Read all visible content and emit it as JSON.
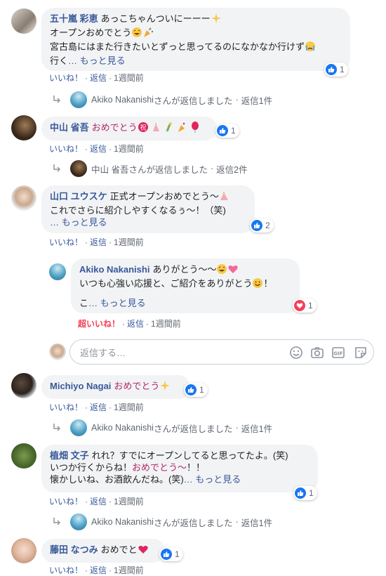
{
  "comments": [
    {
      "author": "五十嵐 彩恵",
      "text_line1": "あっこちゃんついにーーー",
      "text_line2": "オープンおめでとう",
      "text_line3": "宮古島にはまた行きたいとずっと思ってるのになかなか行けず",
      "text_line4": "行く",
      "see_more": "… もっと見る",
      "reaction_count": "1",
      "like": "いいね！",
      "reply": "返信",
      "time": "1週間前",
      "reply_summary": {
        "name": "Akiko Nakanishi",
        "suffix": "さんが返信しました",
        "count": "返信1件"
      }
    },
    {
      "author": "中山 省吾",
      "text": "おめでとう",
      "reaction_count": "1",
      "like": "いいね！",
      "reply": "返信",
      "time": "1週間前",
      "reply_summary": {
        "name": "中山 省吾",
        "suffix": "さんが返信しました",
        "count": "返信2件"
      }
    },
    {
      "author": "山口 ユウスケ",
      "text_line1": "正式オープンおめでとう〜",
      "text_line2": "これでさらに紹介しやすくなるぅ〜！（笑)",
      "see_more": "… もっと見る",
      "reaction_count": "2",
      "like": "いいね！",
      "reply": "返信",
      "time": "1週間前"
    },
    {
      "author": "Akiko Nakanishi",
      "text_line1": "ありがとう〜〜",
      "text_line2": "いつも心強い応援と、ご紹介をありがとう",
      "text_line2_end": "！",
      "text_line3": "こ",
      "see_more": "… もっと見る",
      "reaction_count": "1",
      "like": "超いいね！",
      "reply": "返信",
      "time": "1週間前"
    },
    {
      "author": "Michiyo Nagai",
      "text": "おめでとう",
      "reaction_count": "1",
      "like": "いいね！",
      "reply": "返信",
      "time": "1週間前",
      "reply_summary": {
        "name": "Akiko Nakanishi",
        "suffix": "さんが返信しました",
        "count": "返信1件"
      }
    },
    {
      "author": "植畑 文子",
      "text_line1": "れれ？すでにオープンしてると思ってたよ。(笑)",
      "text_line2a": "いつか行くからね！",
      "text_line2b": "おめでとう〜",
      "text_line2c": "！！",
      "text_line3": "懐かしいね、お酒飲んだね。(笑)",
      "see_more": "… もっと見る",
      "reaction_count": "1",
      "like": "いいね！",
      "reply": "返信",
      "time": "1週間前",
      "reply_summary": {
        "name": "Akiko Nakanishi",
        "suffix": "さんが返信しました",
        "count": "返信1件"
      }
    },
    {
      "author": "藤田 なつみ",
      "text": "おめでと",
      "reaction_count": "1",
      "like": "いいね！",
      "reply": "返信",
      "time": "1週間前"
    }
  ],
  "reply_input": {
    "placeholder": "返信する…"
  },
  "colors": {
    "link": "#385898",
    "like_blue": "#1877f2",
    "love_red": "#f33e58",
    "bubble": "#f2f3f5"
  }
}
